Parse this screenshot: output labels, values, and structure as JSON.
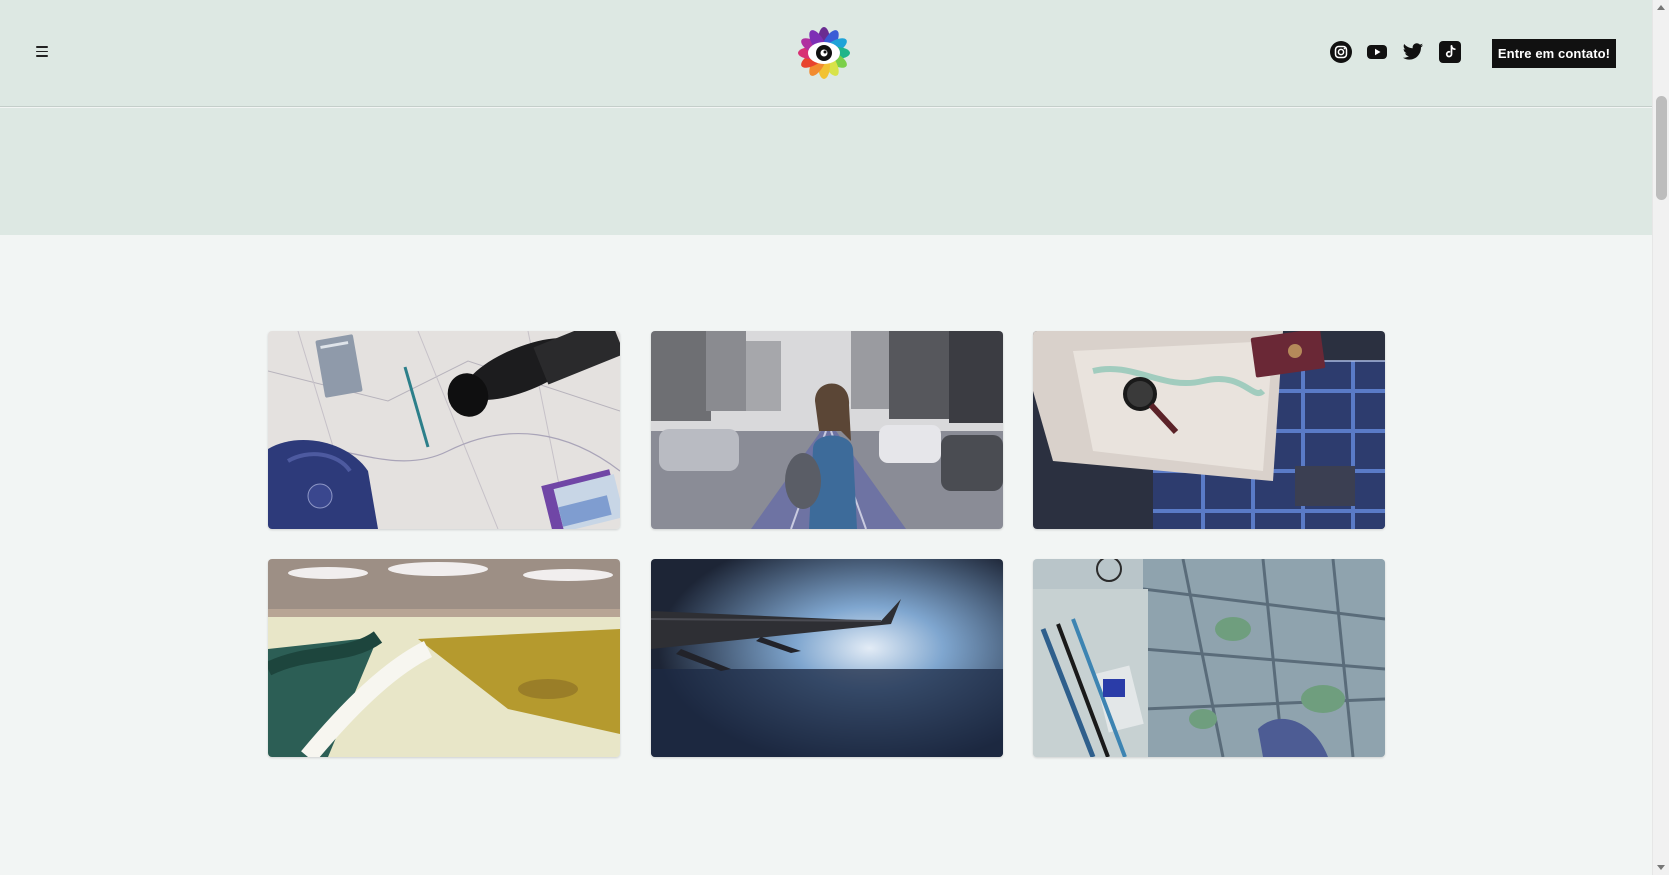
{
  "header": {
    "menu_icon": "hamburger-menu-icon",
    "logo_icon": "eye-flower-logo",
    "social_icons": [
      "instagram-icon",
      "youtube-icon",
      "twitter-icon",
      "tiktok-icon"
    ],
    "contact_button_label": "Entre em contato!"
  },
  "colors": {
    "header_bg": "#dde8e3",
    "page_bg": "#f2f5f4",
    "button_bg": "#111111",
    "button_text": "#ffffff"
  },
  "gallery": {
    "images": [
      {
        "subject": "map-notebook-camera-backpack"
      },
      {
        "subject": "woman-backpack-city-street"
      },
      {
        "subject": "map-magnifier-suitcase-passport"
      },
      {
        "subject": "aerial-lake-shore"
      },
      {
        "subject": "airplane-wing-sky"
      },
      {
        "subject": "city-map-pens-notebook"
      }
    ]
  }
}
